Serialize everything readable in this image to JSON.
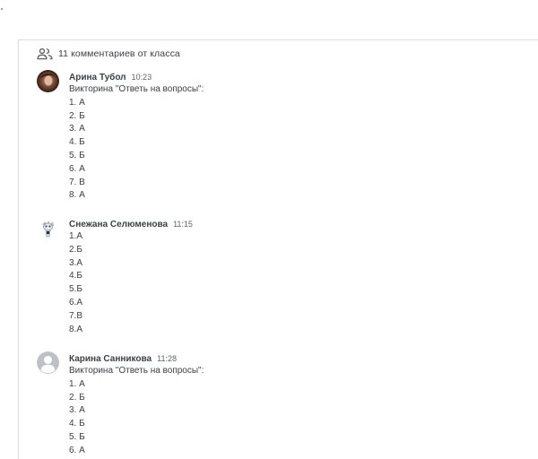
{
  "header": {
    "icon": "people-icon",
    "label": "11 комментариев от класса"
  },
  "comments": [
    {
      "author": "Арина Тубол",
      "time": "10:23",
      "avatar": "avatar-photo",
      "lines": [
        "Викторина \"Ответь на вопросы\":",
        "1. А",
        "2. Б",
        "3. А",
        "4. Б",
        "5. Б",
        "6. А",
        "7. В",
        "8. А"
      ]
    },
    {
      "author": "Снежана Селюменова",
      "time": "11:15",
      "avatar": "avatar-character",
      "lines": [
        "1.А",
        "2.Б",
        "3.А",
        "4.Б",
        "5.Б",
        "6.А",
        "7.В",
        "8.А"
      ]
    },
    {
      "author": "Карина Санникова",
      "time": "11:28",
      "avatar": "avatar-default",
      "lines": [
        "Викторина \"Ответь на вопросы\":",
        "1. А",
        "2. Б",
        "3. А",
        "4. Б",
        "5. Б",
        "6. А"
      ]
    }
  ],
  "colors": {
    "text": "#3c4043",
    "muted": "#5f6368",
    "border": "#dadce0"
  }
}
